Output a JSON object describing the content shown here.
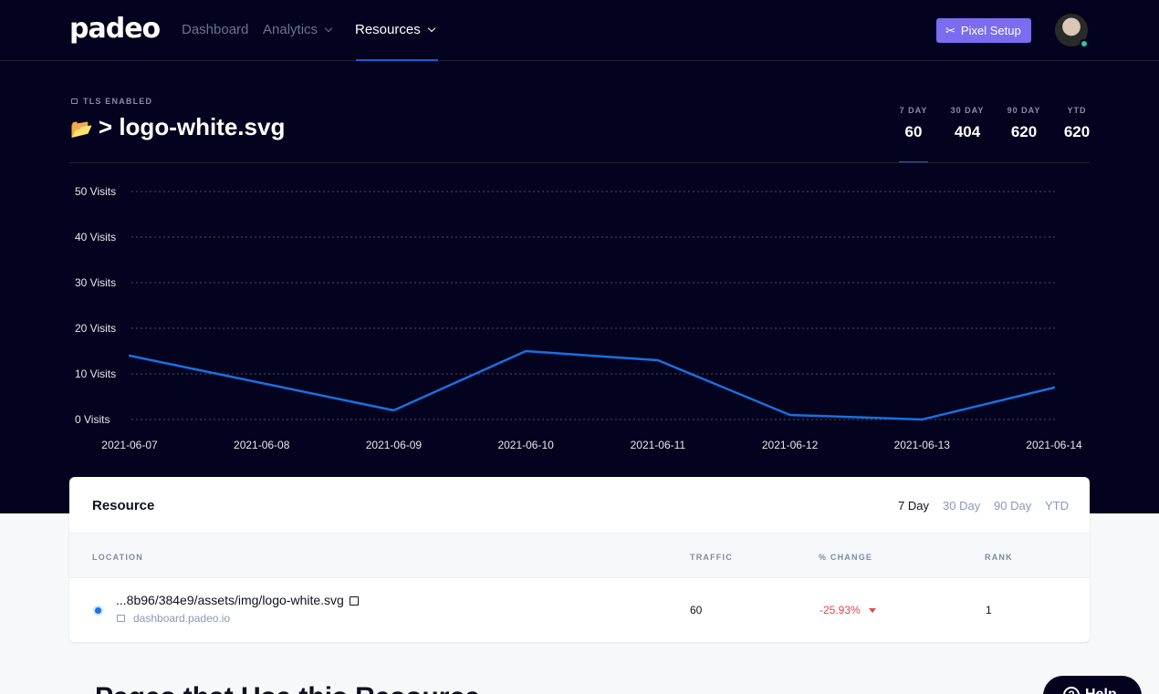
{
  "nav": {
    "logo": "padeo",
    "links": [
      "Dashboard",
      "Analytics",
      "Resources"
    ],
    "pixel_setup": "Pixel Setup"
  },
  "header": {
    "tls": "TLS ENABLED",
    "title": "logo-white.svg",
    "stats": [
      {
        "label": "7 DAY",
        "value": "60"
      },
      {
        "label": "30 DAY",
        "value": "404"
      },
      {
        "label": "90 DAY",
        "value": "620"
      },
      {
        "label": "YTD",
        "value": "620"
      }
    ]
  },
  "chart_data": {
    "type": "line",
    "categories": [
      "2021-06-07",
      "2021-06-08",
      "2021-06-09",
      "2021-06-10",
      "2021-06-11",
      "2021-06-12",
      "2021-06-13",
      "2021-06-14"
    ],
    "series": [
      {
        "values": [
          14,
          8,
          2,
          15,
          13,
          1,
          0,
          7
        ],
        "color": "#1a6fe0"
      }
    ],
    "yticks": [
      "0 Visits",
      "10 Visits",
      "20 Visits",
      "30 Visits",
      "40 Visits",
      "50 Visits"
    ],
    "ylim": [
      0,
      50
    ],
    "grid": true
  },
  "table": {
    "title": "Resource",
    "tabs": [
      "7 Day",
      "30 Day",
      "90 Day",
      "YTD"
    ],
    "columns": [
      "LOCATION",
      "TRAFFIC",
      "% CHANGE",
      "RANK"
    ],
    "row": {
      "path": "...8b96/384e9/assets/img/logo-white.svg",
      "host": "dashboard.padeo.io",
      "traffic": "60",
      "change": "-25.93%",
      "rank": "1"
    }
  },
  "bottom": {
    "heading": "Pages that Use this Resource",
    "help": "Help"
  },
  "colors": {
    "hero_bg": "#03031f",
    "accent": "#1a6fe0",
    "pixel_btn": "#7b6cf0",
    "negative": "#e0444b"
  }
}
